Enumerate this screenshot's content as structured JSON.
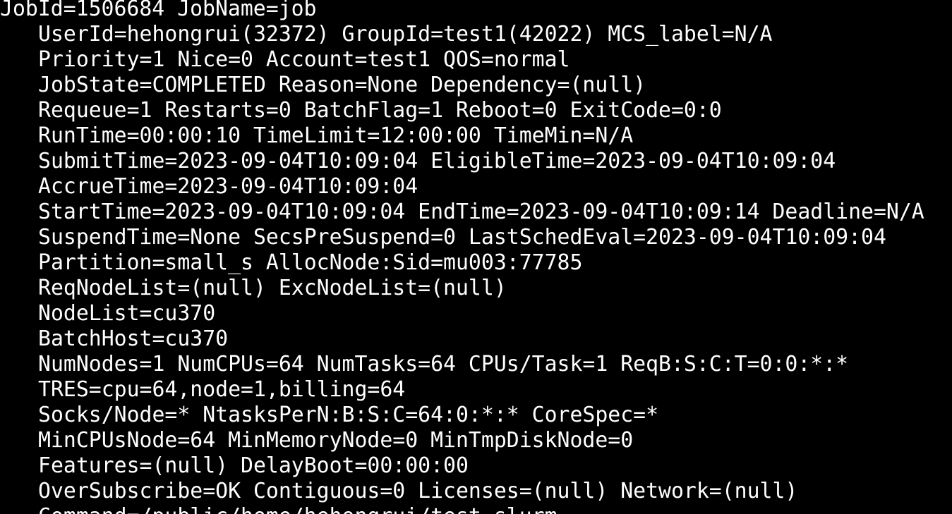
{
  "terminal": {
    "background": "#000000",
    "foreground": "#ffffff",
    "lines": [
      "JobId=1506684 JobName=job",
      "UserId=hehongrui(32372) GroupId=test1(42022) MCS_label=N/A",
      "Priority=1 Nice=0 Account=test1 QOS=normal",
      "JobState=COMPLETED Reason=None Dependency=(null)",
      "Requeue=1 Restarts=0 BatchFlag=1 Reboot=0 ExitCode=0:0",
      "RunTime=00:00:10 TimeLimit=12:00:00 TimeMin=N/A",
      "SubmitTime=2023-09-04T10:09:04 EligibleTime=2023-09-04T10:09:04",
      "AccrueTime=2023-09-04T10:09:04",
      "StartTime=2023-09-04T10:09:04 EndTime=2023-09-04T10:09:14 Deadline=N/A",
      "SuspendTime=None SecsPreSuspend=0 LastSchedEval=2023-09-04T10:09:04",
      "Partition=small_s AllocNode:Sid=mu003:77785",
      "ReqNodeList=(null) ExcNodeList=(null)",
      "NodeList=cu370",
      "BatchHost=cu370",
      "NumNodes=1 NumCPUs=64 NumTasks=64 CPUs/Task=1 ReqB:S:C:T=0:0:*:*",
      "TRES=cpu=64,node=1,billing=64",
      "Socks/Node=* NtasksPerN:B:S:C=64:0:*:* CoreSpec=*",
      "MinCPUsNode=64 MinMemoryNode=0 MinTmpDiskNode=0",
      "Features=(null) DelayBoot=00:00:00",
      "OverSubscribe=OK Contiguous=0 Licenses=(null) Network=(null)",
      "Command=/public/home/hehongrui/test_slurm"
    ]
  }
}
